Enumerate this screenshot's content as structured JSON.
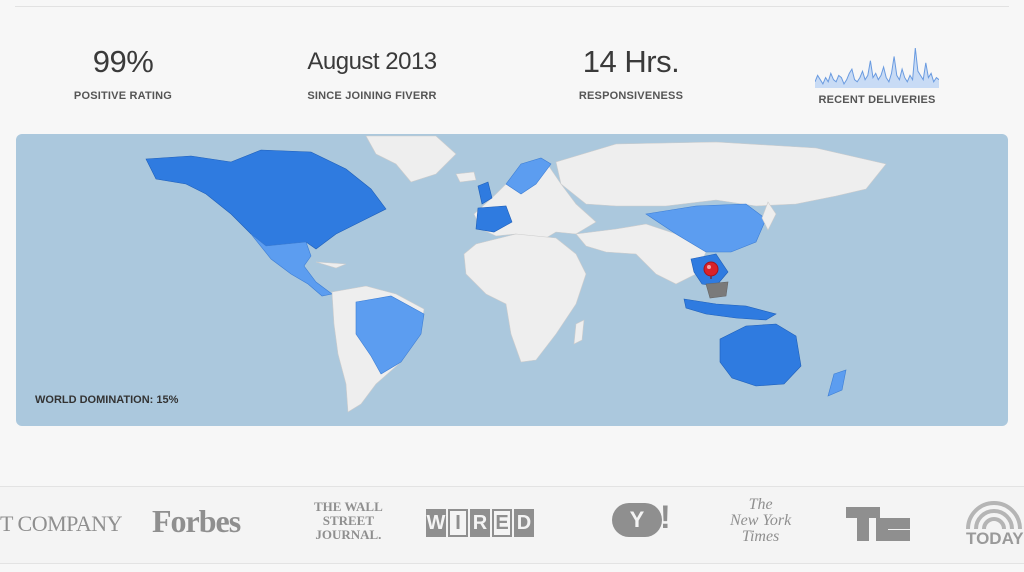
{
  "stats": [
    {
      "value": "99%",
      "label": "POSITIVE RATING"
    },
    {
      "value": "August 2013",
      "label": "SINCE JOINING FIVERR"
    },
    {
      "value": "14 Hrs.",
      "label": "RESPONSIVENESS"
    },
    {
      "label": "RECENT DELIVERIES"
    }
  ],
  "sparkline": {
    "values": [
      2,
      5,
      3,
      1,
      4,
      2,
      6,
      3,
      2,
      5,
      4,
      1,
      3,
      6,
      8,
      3,
      2,
      4,
      7,
      3,
      5,
      12,
      4,
      6,
      3,
      5,
      9,
      4,
      2,
      6,
      14,
      5,
      3,
      8,
      4,
      2,
      5,
      3,
      18,
      7,
      5,
      3,
      11,
      4,
      6,
      2,
      4,
      3
    ],
    "color": "#6a9be0",
    "fill": "#c8dbf5"
  },
  "map": {
    "caption": "WORLD DOMINATION: 15%",
    "ocean_color": "#abc8dd",
    "land_color": "#eeeeee",
    "highlight_dark": "#2f7be0",
    "highlight_light": "#5c9df0",
    "pin_color": "#d9222a",
    "marker_label": "pin-icon"
  },
  "press": {
    "fastcompany": "T COMPANY",
    "forbes": "Forbes",
    "wsj": [
      "THE WALL",
      "STREET",
      "JOURNAL."
    ],
    "wired": [
      "W",
      "I",
      "R",
      "E",
      "D"
    ],
    "yahoo": "Y",
    "yahoo_bang": "!",
    "nyt": [
      "The",
      "New York",
      "Times"
    ],
    "today": "TODAY"
  }
}
